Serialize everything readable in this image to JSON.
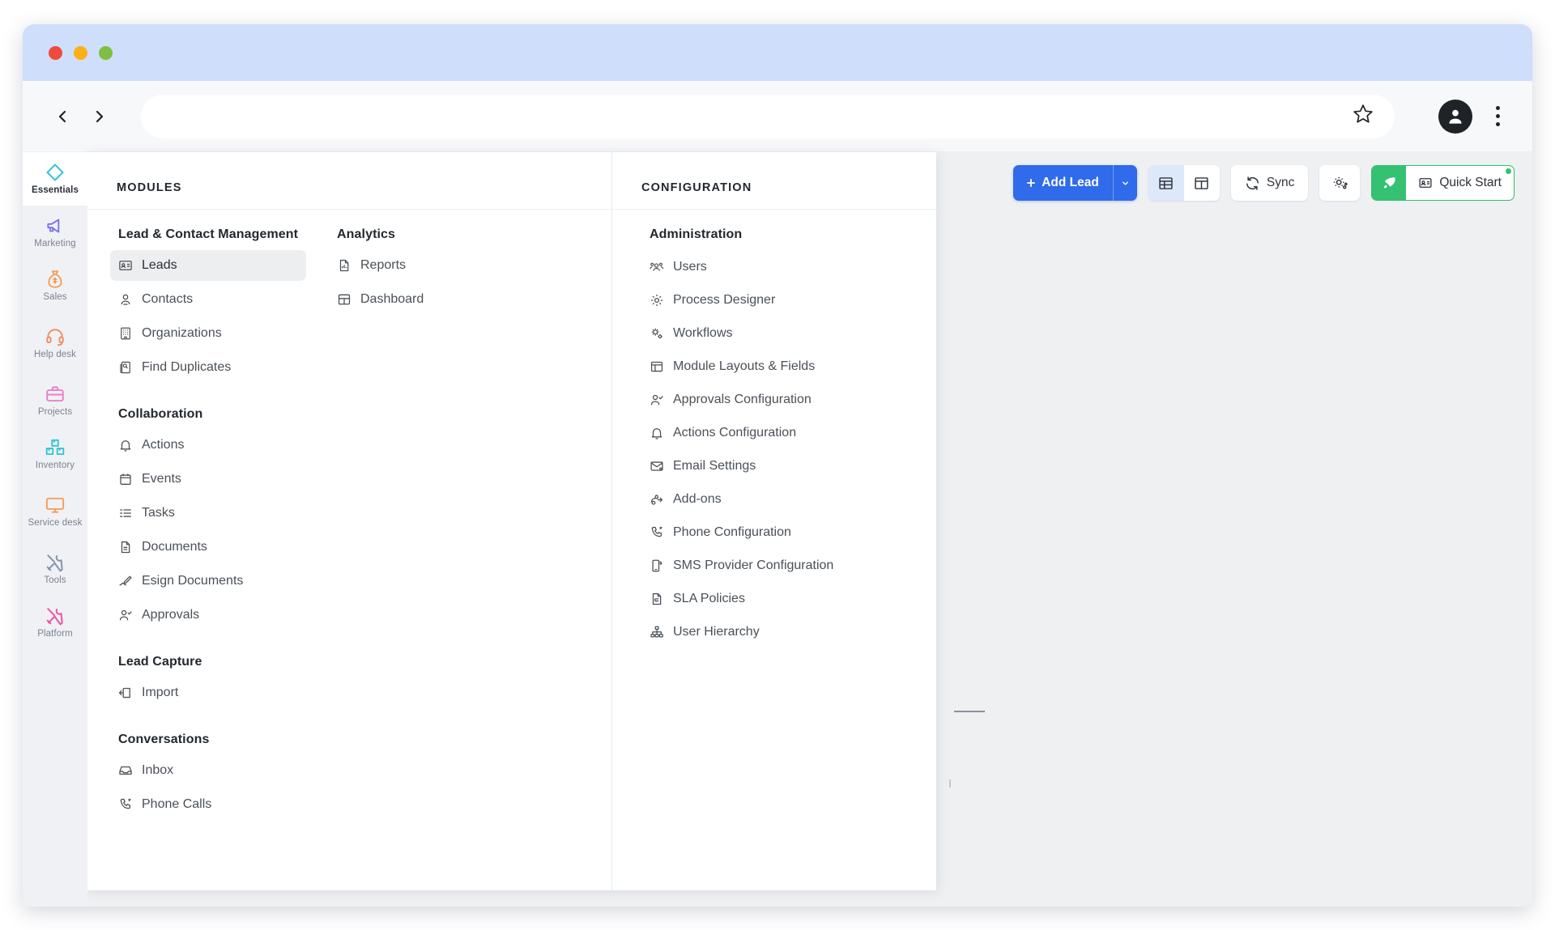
{
  "browser": {
    "omnibox_value": "",
    "omnibox_placeholder": "",
    "back_icon": "chevron-left-icon",
    "forward_icon": "chevron-right-icon",
    "bookmark_icon": "star-icon",
    "profile_icon": "account-avatar-icon",
    "menu_icon": "kebab-menu-icon"
  },
  "rail": {
    "items": [
      {
        "label": "Essentials",
        "icon": "diamond-icon",
        "color": "#2fc4d6",
        "active": true
      },
      {
        "label": "Marketing",
        "icon": "megaphone-icon",
        "color": "#7b6ff0",
        "active": false
      },
      {
        "label": "Sales",
        "icon": "money-bag-icon",
        "color": "#f59b54",
        "active": false
      },
      {
        "label": "Help desk",
        "icon": "headset-icon",
        "color": "#f08a5d",
        "active": false
      },
      {
        "label": "Projects",
        "icon": "briefcase-icon",
        "color": "#e87bc4",
        "active": false
      },
      {
        "label": "Inventory",
        "icon": "boxes-icon",
        "color": "#2fc4d6",
        "active": false
      },
      {
        "label": "Service desk",
        "icon": "monitor-icon",
        "color": "#f59b54",
        "active": false
      },
      {
        "label": "Tools",
        "icon": "tools-icon",
        "color": "#8492a6",
        "active": false
      },
      {
        "label": "Platform",
        "icon": "tools-pink-icon",
        "color": "#ef4fa3",
        "active": false
      }
    ]
  },
  "mega_menu": {
    "modules_header": "MODULES",
    "config_header": "CONFIGURATION",
    "groups": {
      "lead_contact": {
        "title": "Lead & Contact Management",
        "items": [
          {
            "label": "Leads",
            "icon": "contact-card-icon",
            "selected": true
          },
          {
            "label": "Contacts",
            "icon": "person-icon",
            "selected": false
          },
          {
            "label": "Organizations",
            "icon": "building-icon",
            "selected": false
          },
          {
            "label": "Find Duplicates",
            "icon": "duplicate-icon",
            "selected": false
          }
        ]
      },
      "collaboration": {
        "title": "Collaboration",
        "items": [
          {
            "label": "Actions",
            "icon": "bell-icon"
          },
          {
            "label": "Events",
            "icon": "calendar-icon"
          },
          {
            "label": "Tasks",
            "icon": "task-list-icon"
          },
          {
            "label": "Documents",
            "icon": "document-icon"
          },
          {
            "label": "Esign Documents",
            "icon": "signature-pen-icon"
          },
          {
            "label": "Approvals",
            "icon": "person-check-icon"
          }
        ]
      },
      "lead_capture": {
        "title": "Lead Capture",
        "items": [
          {
            "label": "Import",
            "icon": "import-icon"
          }
        ]
      },
      "conversations": {
        "title": "Conversations",
        "items": [
          {
            "label": "Inbox",
            "icon": "inbox-icon"
          },
          {
            "label": "Phone Calls",
            "icon": "phone-icon"
          }
        ]
      },
      "analytics": {
        "title": "Analytics",
        "items": [
          {
            "label": "Reports",
            "icon": "report-file-icon"
          },
          {
            "label": "Dashboard",
            "icon": "dashboard-grid-icon"
          }
        ]
      },
      "administration": {
        "title": "Administration",
        "items": [
          {
            "label": "Users",
            "icon": "users-group-icon"
          },
          {
            "label": "Process Designer",
            "icon": "gear-icon"
          },
          {
            "label": "Workflows",
            "icon": "workflow-gears-icon"
          },
          {
            "label": "Module Layouts & Fields",
            "icon": "layout-icon"
          },
          {
            "label": "Approvals Configuration",
            "icon": "person-check-icon"
          },
          {
            "label": "Actions Configuration",
            "icon": "bell-icon"
          },
          {
            "label": "Email Settings",
            "icon": "envelope-gear-icon"
          },
          {
            "label": "Add-ons",
            "icon": "addon-plug-icon"
          },
          {
            "label": "Phone Configuration",
            "icon": "phone-icon"
          },
          {
            "label": "SMS Provider Configuration",
            "icon": "sms-icon"
          },
          {
            "label": "SLA Policies",
            "icon": "policy-file-icon"
          },
          {
            "label": "User Hierarchy",
            "icon": "hierarchy-icon"
          }
        ]
      }
    }
  },
  "toolbar": {
    "add_lead_label": "Add Lead",
    "add_lead_caret_icon": "chevron-down-icon",
    "view_table_icon": "table-view-icon",
    "view_kanban_icon": "kanban-view-icon",
    "sync_label": "Sync",
    "sync_icon": "sync-refresh-icon",
    "settings_icon": "settings-gear-icon",
    "quick_start_label": "Quick Start",
    "quick_start_icon": "quick-start-card-icon",
    "rocket_icon": "rocket-icon"
  },
  "colors": {
    "primary_blue": "#2f6bea",
    "success_green": "#35c172",
    "titlebar_blue": "#cfdefb",
    "accent_cyan": "#2fc4d6",
    "canvas_grey": "#eef0f2"
  }
}
